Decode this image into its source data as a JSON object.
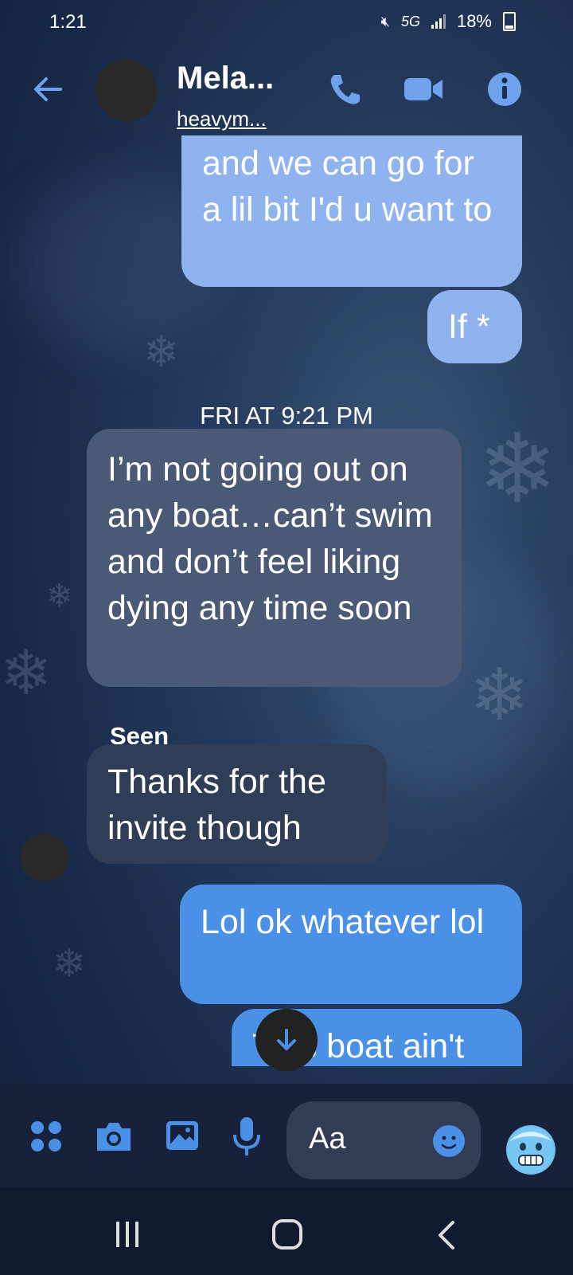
{
  "status_bar": {
    "time": "1:21",
    "network": "5G",
    "battery": "18%"
  },
  "header": {
    "contact_name": "Mela...",
    "contact_handle": "heavym..."
  },
  "messages": [
    {
      "text": "and we can go for a lil bit I'd u want to",
      "direction": "outgoing"
    },
    {
      "text": "If *",
      "direction": "outgoing"
    },
    {
      "text": "I’m not going out on any boat…can’t swim and don’t feel liking dying any time soon",
      "direction": "incoming"
    },
    {
      "text": "Thanks for the invite though",
      "direction": "incoming"
    },
    {
      "text": "Lol ok whatever lol",
      "direction": "outgoing"
    },
    {
      "text": "This boat ain't",
      "direction": "outgoing"
    }
  ],
  "timestamp": "FRI AT 9:21 PM",
  "seen_label": "Seen",
  "composer": {
    "placeholder": "Aa"
  },
  "icons": {
    "back": "back-arrow-icon",
    "call": "phone-icon",
    "video": "video-camera-icon",
    "info": "info-icon",
    "apps": "apps-grid-icon",
    "camera": "camera-icon",
    "gallery": "gallery-icon",
    "mic": "microphone-icon",
    "emoji": "emoji-icon",
    "quick_reaction": "cold-face-emoji-icon",
    "scroll_down": "arrow-down-icon"
  },
  "colors": {
    "accent": "#4a90e6",
    "outgoing_bubble": "#8eb3ee",
    "incoming_bubble": "#4a5a76"
  }
}
